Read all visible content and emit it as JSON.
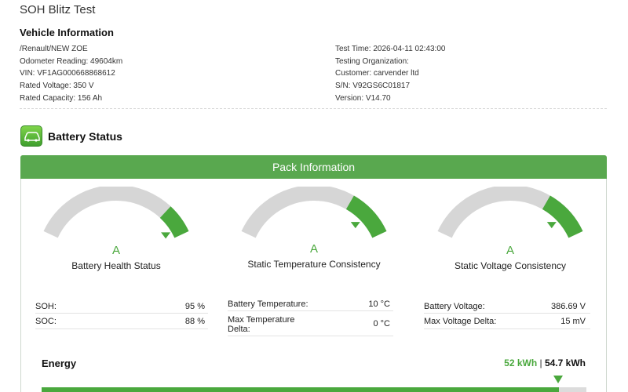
{
  "report": {
    "title": "SOH Blitz Test"
  },
  "vehicle": {
    "heading": "Vehicle Information",
    "left": [
      "/Renault/NEW ZOE",
      "Odometer Reading: 49604km",
      "VIN: VF1AG000668868612",
      "Rated Voltage: 350 V",
      "Rated Capacity: 156 Ah"
    ],
    "right": [
      "Test Time: 2026-04-11 02:43:00",
      "Testing Organization:",
      "Customer: carvender ltd",
      "S/N: V92GS6C01817",
      "Version: V14.70"
    ]
  },
  "battery_status": {
    "heading": "Battery Status",
    "icon": "battery-car-icon"
  },
  "pack": {
    "header": "Pack Information",
    "gauges": [
      {
        "name": "Battery Health Status",
        "grade": "A",
        "level": 0.95
      },
      {
        "name": "Static Temperature Consistency",
        "grade": "A",
        "level": 0.85
      },
      {
        "name": "Static Voltage Consistency",
        "grade": "A",
        "level": 0.85
      }
    ],
    "metrics": [
      [
        {
          "label": "SOH:",
          "value": "95 %"
        },
        {
          "label": "SOC:",
          "value": "88 %"
        }
      ],
      [
        {
          "label": "Battery Temperature:",
          "value": "10 °C"
        },
        {
          "label": "Max Temperature Delta:",
          "value": "0 °C"
        }
      ],
      [
        {
          "label": "Battery Voltage:",
          "value": "386.69 V"
        },
        {
          "label": "Max Voltage Delta:",
          "value": "15 mV"
        }
      ]
    ]
  },
  "energy": {
    "label": "Energy",
    "current": "52 kWh",
    "separator": "|",
    "total": "54.7 kWh",
    "fraction": 0.95
  },
  "colors": {
    "accent": "#4aa83d",
    "header": "#59a84f",
    "track": "#d6d6d6"
  }
}
